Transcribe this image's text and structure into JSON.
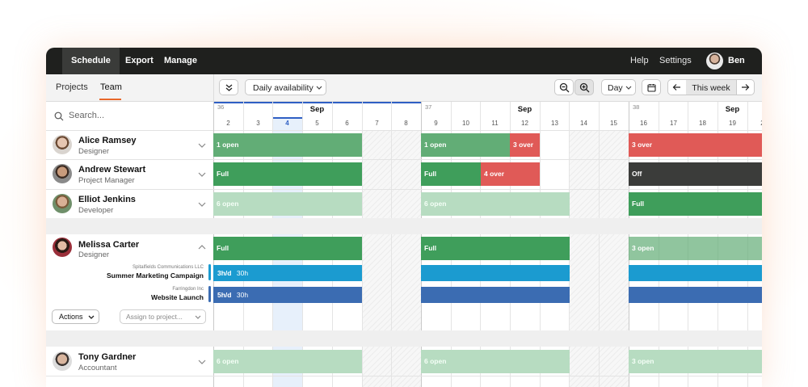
{
  "nav": {
    "left": [
      "Schedule",
      "Export",
      "Manage"
    ],
    "help": "Help",
    "settings": "Settings",
    "user": "Ben"
  },
  "tabs": {
    "projects": "Projects",
    "team": "Team"
  },
  "toolbar": {
    "availability": "Daily availability",
    "view": "Day",
    "this_week": "This week"
  },
  "search": {
    "placeholder": "Search..."
  },
  "calendar": {
    "weeks": [
      {
        "num": "36",
        "month": "Sep"
      },
      {
        "num": "37",
        "month": "Sep"
      },
      {
        "num": "38",
        "month": "Sep"
      }
    ],
    "days": [
      "2",
      "3",
      "4",
      "5",
      "6",
      "7",
      "8",
      "9",
      "10",
      "11",
      "12",
      "13",
      "14",
      "15",
      "16",
      "17",
      "18",
      "19",
      "2"
    ],
    "today": "4"
  },
  "people": [
    {
      "name": "Alice Ramsey",
      "role": "Designer"
    },
    {
      "name": "Andrew Stewart",
      "role": "Project Manager"
    },
    {
      "name": "Elliot Jenkins",
      "role": "Developer"
    },
    {
      "name": "Melissa Carter",
      "role": "Designer"
    },
    {
      "name": "Tony Gardner",
      "role": "Accountant"
    }
  ],
  "bars": {
    "alice": [
      "1 open",
      "1 open",
      "3 over",
      "3 over"
    ],
    "andrew": [
      "Full",
      "Full",
      "4 over",
      "Off"
    ],
    "elliot": [
      "6 open",
      "6 open",
      "Full"
    ],
    "melissa": [
      "Full",
      "Full",
      "3 open"
    ],
    "tony": [
      "6 open",
      "6 open",
      "3 open"
    ]
  },
  "projects": [
    {
      "client": "Spitalfields Communications LLC",
      "name": "Summer Marketing Campaign",
      "rate": "3h/d",
      "total": "30h",
      "color": "#1b9bd0"
    },
    {
      "client": "Farringdon Inc",
      "name": "Website Launch",
      "rate": "5h/d",
      "total": "30h",
      "color": "#3b6cb2"
    }
  ],
  "actions": {
    "label": "Actions",
    "assign_placeholder": "Assign to project..."
  }
}
